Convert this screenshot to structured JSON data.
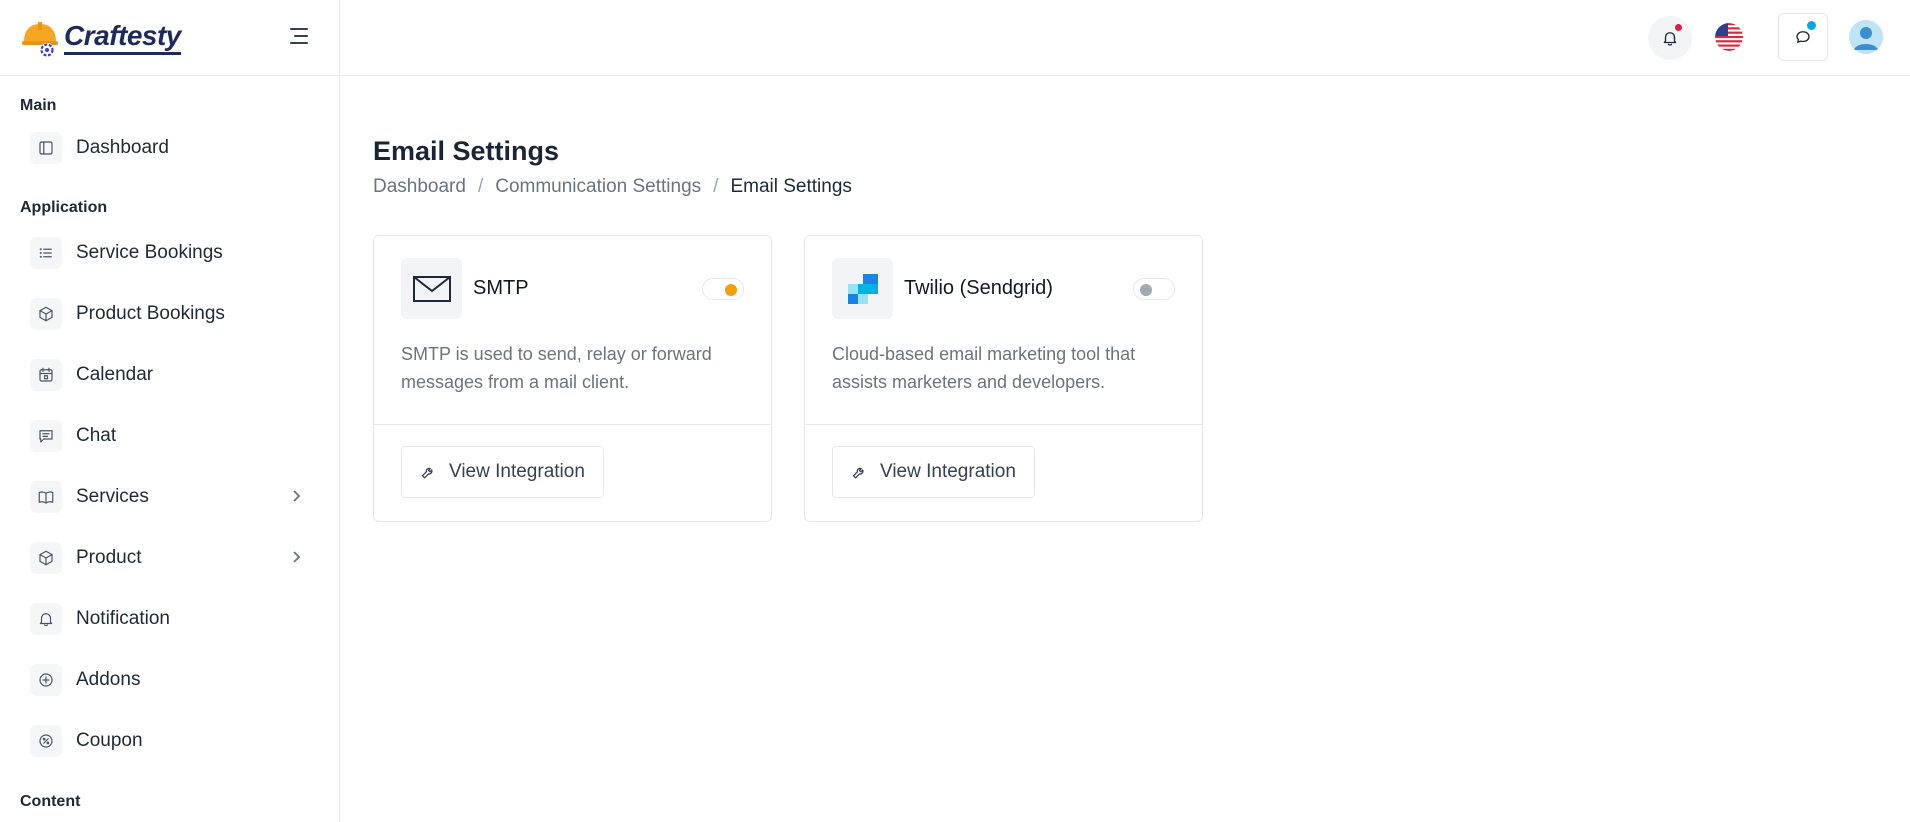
{
  "brand": {
    "name": "Craftesty"
  },
  "sidebar": {
    "sections": [
      {
        "label": "Main"
      },
      {
        "label": "Application"
      },
      {
        "label": "Content"
      }
    ],
    "items": [
      {
        "label": "Dashboard",
        "icon": "layout-sidebar-icon"
      },
      {
        "label": "Service Bookings",
        "icon": "list-icon"
      },
      {
        "label": "Product Bookings",
        "icon": "box-icon"
      },
      {
        "label": "Calendar",
        "icon": "calendar-icon"
      },
      {
        "label": "Chat",
        "icon": "message-icon"
      },
      {
        "label": "Services",
        "icon": "book-icon",
        "expandable": true
      },
      {
        "label": "Product",
        "icon": "box-icon",
        "expandable": true
      },
      {
        "label": "Notification",
        "icon": "bell-icon"
      },
      {
        "label": "Addons",
        "icon": "plus-circle-icon"
      },
      {
        "label": "Coupon",
        "icon": "discount-icon"
      }
    ]
  },
  "header": {
    "icons": [
      "bell-icon",
      "us-flag-icon",
      "chat-icon",
      "avatar"
    ],
    "colors": {
      "notification_dot": "#e11d48",
      "chat_dot": "#0ea5e9"
    }
  },
  "page": {
    "title": "Email Settings",
    "breadcrumb": [
      "Dashboard",
      "Communication Settings",
      "Email Settings"
    ]
  },
  "cards": [
    {
      "name": "SMTP",
      "description": "SMTP is used to send, relay or forward messages from a mail client.",
      "enabled": true,
      "button_label": "View Integration",
      "icon": "envelope-icon"
    },
    {
      "name": "Twilio (Sendgrid)",
      "description": "Cloud-based email marketing tool that assists marketers and developers.",
      "enabled": false,
      "button_label": "View Integration",
      "icon": "sendgrid-logo-icon"
    }
  ],
  "colors": {
    "accent": "#f59e0b",
    "text_dark": "#1b2437",
    "muted": "#6b7280"
  }
}
